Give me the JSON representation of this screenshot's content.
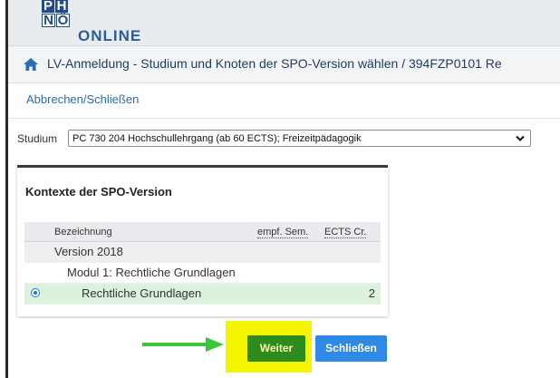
{
  "header": {
    "logo_top": [
      "P",
      "H"
    ],
    "logo_bottom": [
      "N",
      "Ö"
    ],
    "logo_text": "ONLINE"
  },
  "titlebar": {
    "home_icon": "home-icon",
    "title": "LV-Anmeldung - Studium und Knoten der SPO-Version wählen  / 394FZP0101 Re"
  },
  "actions": {
    "close_link": "Abbrechen/Schließen"
  },
  "study": {
    "label": "Studium",
    "selected": "PC 730 204 Hochschullehrgang (ab 60 ECTS); Freizeitpädagogik"
  },
  "context": {
    "title": "Kontexte der SPO-Version",
    "columns": {
      "name": "Bezeichnung",
      "semester": "empf. Sem.",
      "ects": "ECTS Cr."
    },
    "rows": [
      {
        "label": "Version 2018",
        "ects": ""
      },
      {
        "label": "Modul 1: Rechtliche Grundlagen",
        "ects": ""
      },
      {
        "label": "Rechtliche Grundlagen",
        "ects": "2",
        "selected": true
      }
    ]
  },
  "buttons": {
    "next": "Weiter",
    "close": "Schließen"
  },
  "colors": {
    "annotation_highlight": "#f6f500",
    "annotation_arrow": "#3cc43c",
    "next_button": "#2e8b1f",
    "close_button": "#2f8ae6",
    "selected_row": "#ddf2dd"
  }
}
